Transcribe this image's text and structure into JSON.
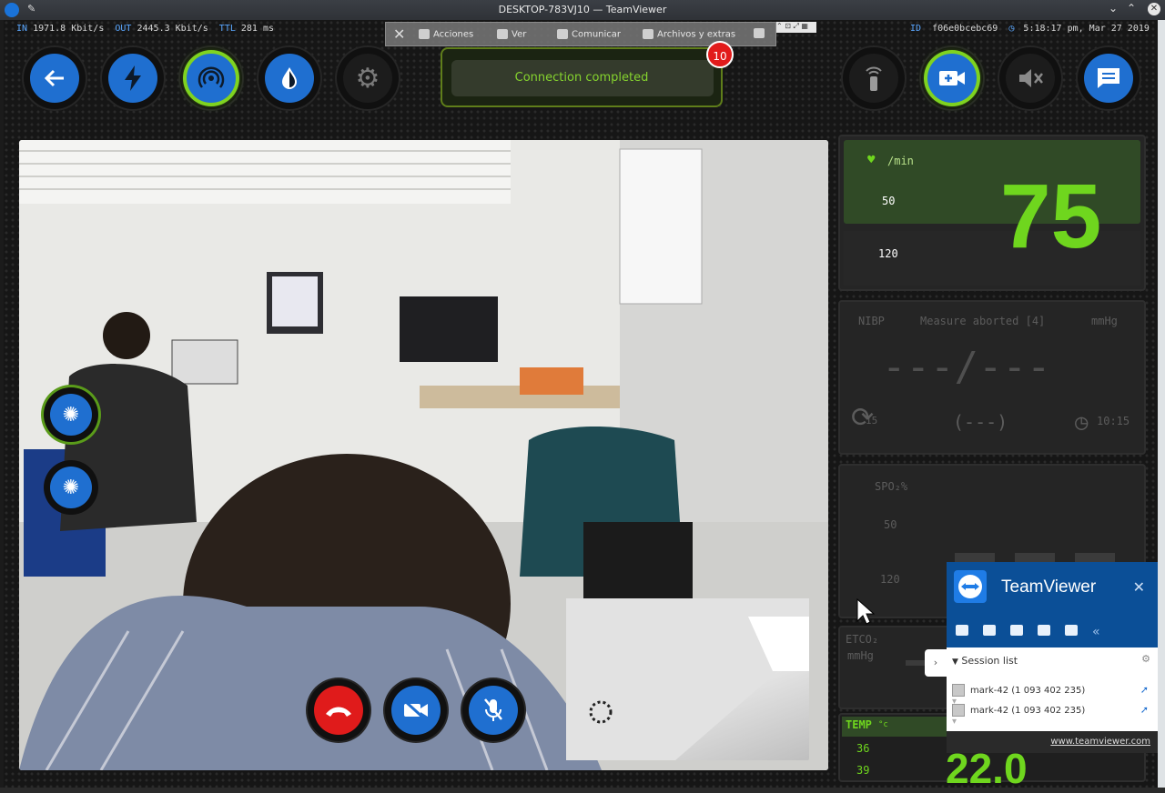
{
  "window": {
    "title": "DESKTOP-783VJ10 — TeamViewer"
  },
  "status": {
    "in_label": "IN",
    "in_value": "1971.8 Kbit/s",
    "out_label": "OUT",
    "out_value": "2445.3 Kbit/s",
    "ttl_label": "TTL",
    "ttl_value": "281 ms",
    "id_label": "ID",
    "id_value": "f06e0bcebc69",
    "datetime": "5:18:17 pm, Mar 27 2019"
  },
  "tv_toolbar": {
    "items": [
      "Acciones",
      "Ver",
      "Comunicar",
      "Archivos y extras"
    ]
  },
  "connection": {
    "status": "Connection completed",
    "badge": "10"
  },
  "top_buttons": [
    "back-arrow-icon",
    "bolt-icon",
    "broadcast-icon",
    "drop-icon",
    "gear-icon",
    "remote-icon",
    "video-call-icon",
    "mute-icon",
    "chat-icon"
  ],
  "vitals": {
    "hr": {
      "unit": "/min",
      "low": "50",
      "high": "120",
      "value": "75"
    },
    "nibp": {
      "label": "NIBP",
      "status": "Measure aborted [4]",
      "unit": "mmHg",
      "reading": "---/---",
      "map": "(---)",
      "interval": "15",
      "time": "10:15"
    },
    "spo2": {
      "label": "SPO₂%",
      "low": "50",
      "high": "120"
    },
    "etco2": {
      "label": "ETCO₂",
      "unit": "mmHg"
    },
    "temp": {
      "label": "TEMP",
      "unit": "°c",
      "low": "36",
      "high": "39",
      "value": "22.0"
    }
  },
  "teamviewer_widget": {
    "name": "TeamViewer",
    "session_title": "Session list",
    "sessions": [
      "mark-42 (1 093 402 235)",
      "mark-42 (1 093 402 235)"
    ],
    "link": "www.teamviewer.com"
  },
  "colors": {
    "accent_green": "#7fd320",
    "button_blue": "#1f6fd0",
    "hr_green": "#6fd61e",
    "tv_blue": "#0b4f97"
  }
}
